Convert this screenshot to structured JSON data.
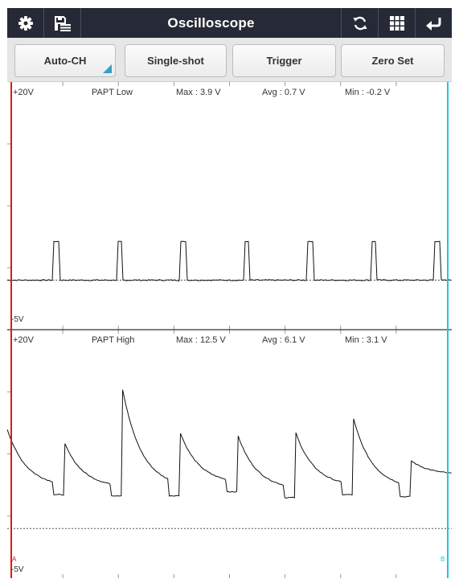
{
  "titlebar": {
    "title": "Oscilloscope",
    "left_icons": [
      "gear-icon",
      "save-list-icon"
    ],
    "right_icons": [
      "refresh-icon",
      "grid-icon",
      "back-icon"
    ],
    "background_color": "#262a36"
  },
  "toolbar": {
    "auto_ch_label": "Auto-CH",
    "single_shot_label": "Single-shot",
    "trigger_label": "Trigger",
    "zero_set_label": "Zero Set",
    "accent_color": "#3b9cc8"
  },
  "channels": [
    {
      "top_label": "+20V",
      "bottom_label": "-5V",
      "name": "PAPT Low",
      "max": "Max : 3.9 V",
      "avg": "Avg : 0.7 V",
      "min": "Min : -0.2 V"
    },
    {
      "top_label": "+20V",
      "bottom_label": "-5V",
      "name": "PAPT High",
      "max": "Max : 12.5 V",
      "avg": "Avg : 6.1 V",
      "min": "Min : 3.1 V"
    }
  ],
  "cursors": {
    "a_label": "A",
    "b_label": "B",
    "a_color": "#e01818",
    "b_color": "#20c8dc"
  },
  "chart_data": {
    "type": "line",
    "series": [
      {
        "name": "PAPT Low",
        "y_range": [
          -5,
          20
        ],
        "pulse_count": 7,
        "baseline": 0.0,
        "pulse_high": 3.9
      },
      {
        "name": "PAPT High",
        "y_range": [
          -5,
          20
        ],
        "peaks": [
          10.0,
          8.5,
          14.0,
          9.6,
          9.3,
          9.6,
          11.0,
          6.8
        ],
        "troughs": [
          3.4,
          3.3,
          3.3,
          3.7,
          3.1,
          3.4,
          3.2,
          4.6
        ]
      }
    ]
  }
}
